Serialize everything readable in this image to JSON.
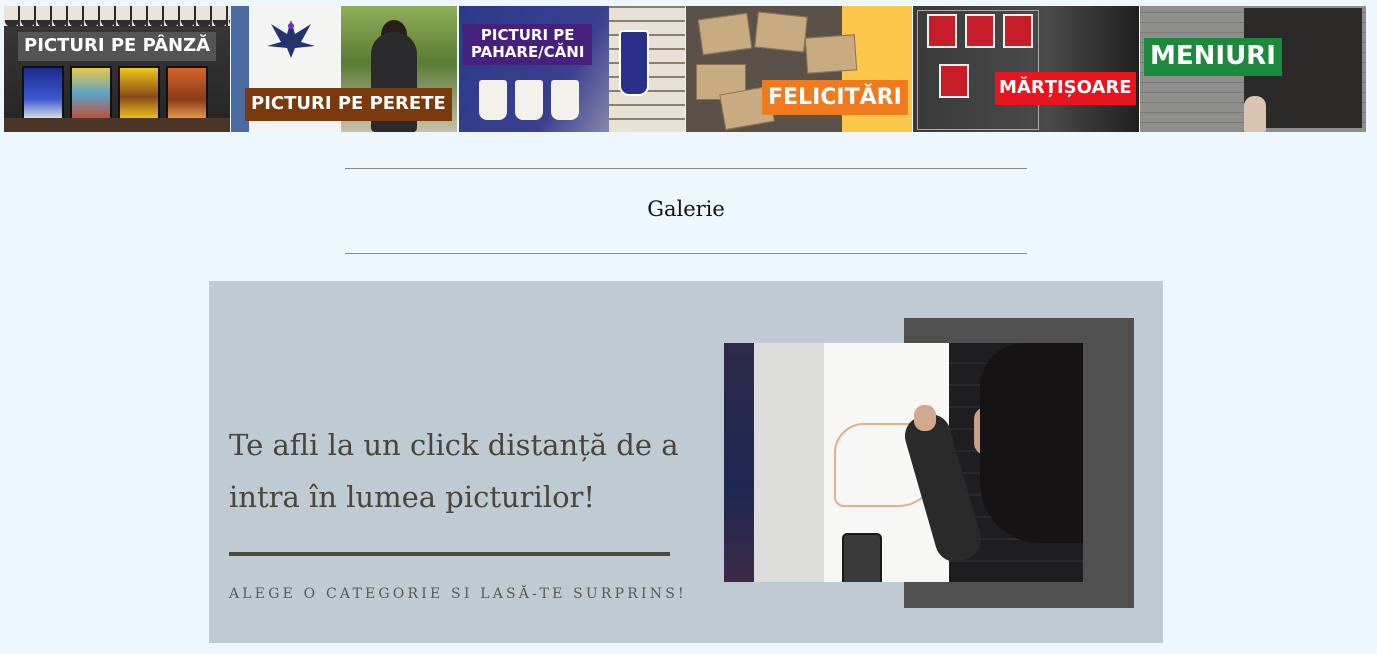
{
  "categories": [
    {
      "label": "PICTURI PE PÂNZĂ"
    },
    {
      "label": "PICTURI PE PERETE"
    },
    {
      "label": "PICTURI PE PAHARE/CĂNI",
      "line1": "PICTURI PE",
      "line2": "PAHARE/CĂNI"
    },
    {
      "label": "FELICITĂRI"
    },
    {
      "label": "MĂRȚIȘOARE"
    },
    {
      "label": "MENIURI"
    }
  ],
  "gallery": {
    "title": "Galerie"
  },
  "banner": {
    "headline_line1": "Te afli la un click distanță de a",
    "headline_line2": "intra în lumea picturilor!",
    "subtitle": "ALEGE O CATEGORIE SI LASĂ-TE SURPRINS!"
  },
  "colors": {
    "page_background": "#eff7fe",
    "banner_background": "#bfcad3",
    "headline_text": "#46463e",
    "label_brown": "#7a3a0e",
    "label_purple": "#45207c",
    "label_orange": "#f07a1e",
    "label_red": "#e8141e",
    "label_green": "#1c8a3c"
  }
}
